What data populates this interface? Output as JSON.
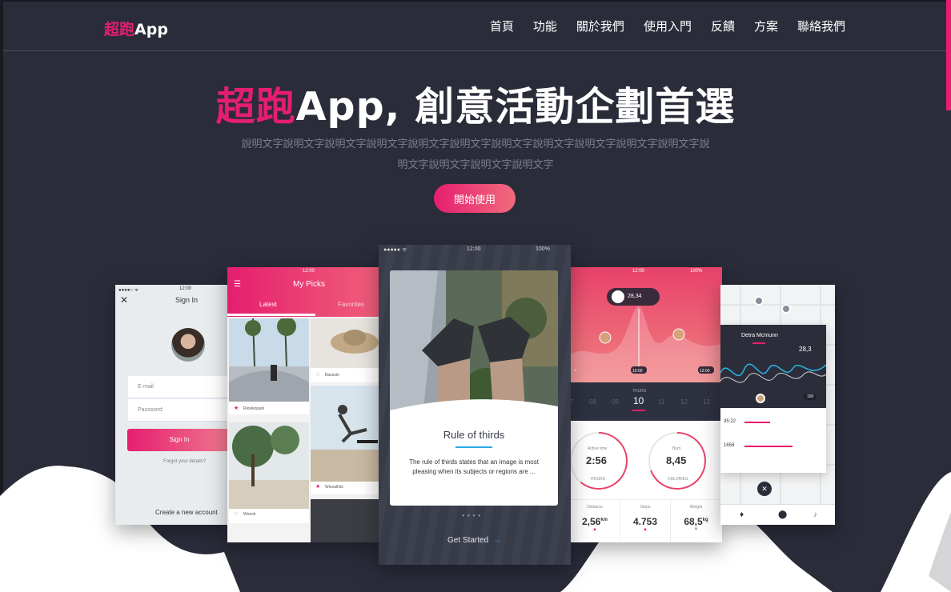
{
  "brand": {
    "accent": "超跑",
    "name": "App"
  },
  "nav": [
    "首頁",
    "功能",
    "關於我們",
    "使用入門",
    "反饋",
    "方案",
    "聯絡我們"
  ],
  "hero": {
    "title_accent": "超跑",
    "title_rest": "App, 創意活動企劃首選",
    "description": "說明文字說明文字說明文字說明文字說明文字說明文字說明文字說明文字說明文字說明文字說明文字說明文字說明文字說明文字說明文字",
    "cta": "開始使用"
  },
  "colors": {
    "accent": "#e51e6f",
    "background": "#2b2c3a",
    "wave": "#ffffff"
  },
  "phone_signin": {
    "time": "12:00",
    "title": "Sign In",
    "email_placeholder": "E-mail",
    "password_placeholder": "Password",
    "signin_label": "Sign In",
    "forgot": "Forgot your details?",
    "create": "Create a new account"
  },
  "phone_picks": {
    "time": "12:00",
    "title": "My Picks",
    "tab_latest": "Latest",
    "tab_favorites": "Favorites",
    "cards": [
      "Ricieknpark",
      "Bassolo",
      "Wicealhdc",
      "Woosh"
    ]
  },
  "phone_center": {
    "time": "12:00",
    "battery": "100%",
    "card_title": "Rule of thirds",
    "card_text": "The rule of thirds states that an image is most pleasing when its subjects or regions are ...",
    "action": "Get Started"
  },
  "phone_fitness": {
    "time": "12:00",
    "battery": "100%",
    "pill": "28,34",
    "day_label": "THURS",
    "days": [
      "07",
      "08",
      "09",
      "10",
      "11",
      "12",
      "13"
    ],
    "active_time": {
      "label": "Active time",
      "value": "2:56",
      "unit": "HOURS"
    },
    "burn": {
      "label": "Burn",
      "value": "8,45",
      "unit": "CALORIES"
    },
    "distance": {
      "label": "Distance",
      "value": "2,56",
      "unit": "km"
    },
    "steps": {
      "label": "Steps",
      "value": "4.753"
    },
    "weight": {
      "label": "Weight",
      "value": "68,5",
      "unit": "kg"
    },
    "time_labels": [
      "10:00",
      "12:00"
    ]
  },
  "phone_map": {
    "name": "Detra Mcmunn",
    "value": "28,3",
    "rows": [
      "35:22",
      "1658"
    ],
    "tag": "150"
  }
}
